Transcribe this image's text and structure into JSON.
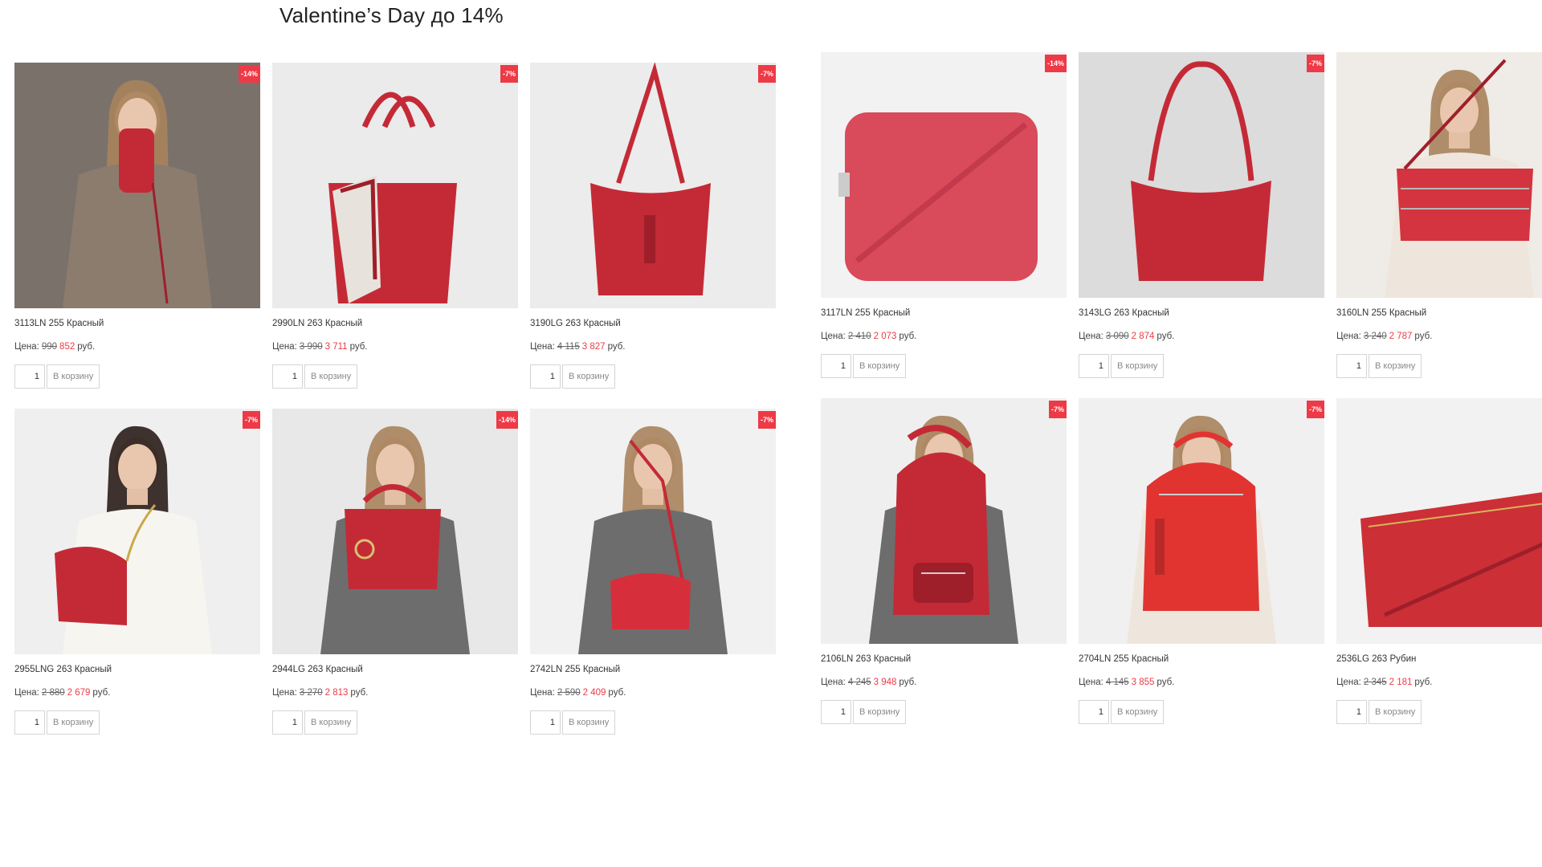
{
  "title": "Valentine’s Day до 14%",
  "price_label": "Цена:",
  "currency": "руб.",
  "cart_label": "В корзину",
  "quantity_default": "1",
  "colors": {
    "accent": "#ee3a46"
  },
  "products": [
    {
      "name": "3113LN 255 Красный",
      "old_price": "990",
      "new_price": "852",
      "discount": "-14%",
      "bg": "#7b716b",
      "bag": "clutch",
      "model": true
    },
    {
      "name": "2990LN 263 Красный",
      "old_price": "3 990",
      "new_price": "3 711",
      "discount": "-7%",
      "bg": "#ebebeb",
      "bag": "tote",
      "model": false
    },
    {
      "name": "3190LG 263 Красный",
      "old_price": "4 115",
      "new_price": "3 827",
      "discount": "-7%",
      "bg": "#ececec",
      "bag": "hobo",
      "model": false
    },
    {
      "name": "3117LN 255 Красный",
      "old_price": "2 410",
      "new_price": "2 073",
      "discount": "-14%",
      "bg": "#f2f2f2",
      "bag": "camera",
      "model": false
    },
    {
      "name": "3143LG 263 Красный",
      "old_price": "3 090",
      "new_price": "2 874",
      "discount": "-7%",
      "bg": "#dcdcdc",
      "bag": "shoulder",
      "model": false
    },
    {
      "name": "3160LN 255 Красный",
      "old_price": "3 240",
      "new_price": "2 787",
      "discount": "",
      "bg": "#efebe6",
      "bag": "crossbody",
      "model": true
    },
    {
      "name": "2955LNG 263 Красный",
      "old_price": "2 880",
      "new_price": "2 679",
      "discount": "-7%",
      "bg": "#efefef",
      "bag": "chainbag",
      "model": true
    },
    {
      "name": "2944LG 263 Красный",
      "old_price": "3 270",
      "new_price": "2 813",
      "discount": "-14%",
      "bg": "#e8e8e8",
      "bag": "satchel",
      "model": true
    },
    {
      "name": "2742LN 255 Красный",
      "old_price": "2 590",
      "new_price": "2 409",
      "discount": "-7%",
      "bg": "#f1f1f1",
      "bag": "smallcross",
      "model": true
    },
    {
      "name": "2106LN 263 Красный",
      "old_price": "4 245",
      "new_price": "3 948",
      "discount": "-7%",
      "bg": "#efefef",
      "bag": "backpack",
      "model": true
    },
    {
      "name": "2704LN 255 Красный",
      "old_price": "4 145",
      "new_price": "3 855",
      "discount": "-7%",
      "bg": "#f0f0f0",
      "bag": "backpack2",
      "model": true
    },
    {
      "name": "2536LG 263 Рубин",
      "old_price": "2 345",
      "new_price": "2 181",
      "discount": "",
      "bg": "#f2f2f2",
      "bag": "pouch",
      "model": false
    }
  ]
}
